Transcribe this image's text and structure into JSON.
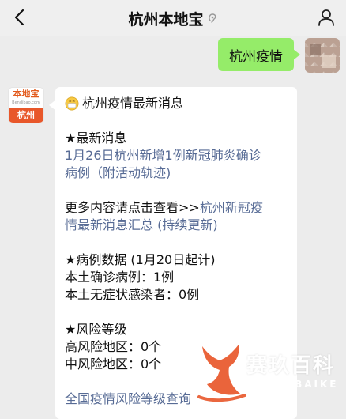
{
  "header": {
    "title": "杭州本地宝"
  },
  "outgoing": {
    "text": "杭州疫情"
  },
  "bot": {
    "avatar_brand": "本地宝",
    "avatar_url": "Bendibao.com",
    "avatar_city": "杭州"
  },
  "message": {
    "heading": "杭州疫情最新消息",
    "latest_title": "★最新消息",
    "latest_link_line1": "1月26日杭州新增1例新冠肺炎确诊",
    "latest_link_line2": "病例（附活动轨迹)",
    "more_prefix": "更多内容请点击查看>>",
    "more_link_part1": "杭州新冠疫",
    "more_link_part2": "情最新消息汇总 (持续更新)",
    "cases_title": "★病例数据 (1月20日起计)",
    "cases_confirmed": "本土确诊病例：1例",
    "cases_asymptomatic": "本土无症状感染者：0例",
    "risk_title": "★风险等级",
    "risk_high": "高风险地区：0个",
    "risk_medium": "中风险地区：0个",
    "risk_link": "全国疫情风险等级查询"
  },
  "watermark": {
    "text": "赛玖百科",
    "sub": "SAIJIUBAIKE",
    "color": "#e8572a"
  }
}
